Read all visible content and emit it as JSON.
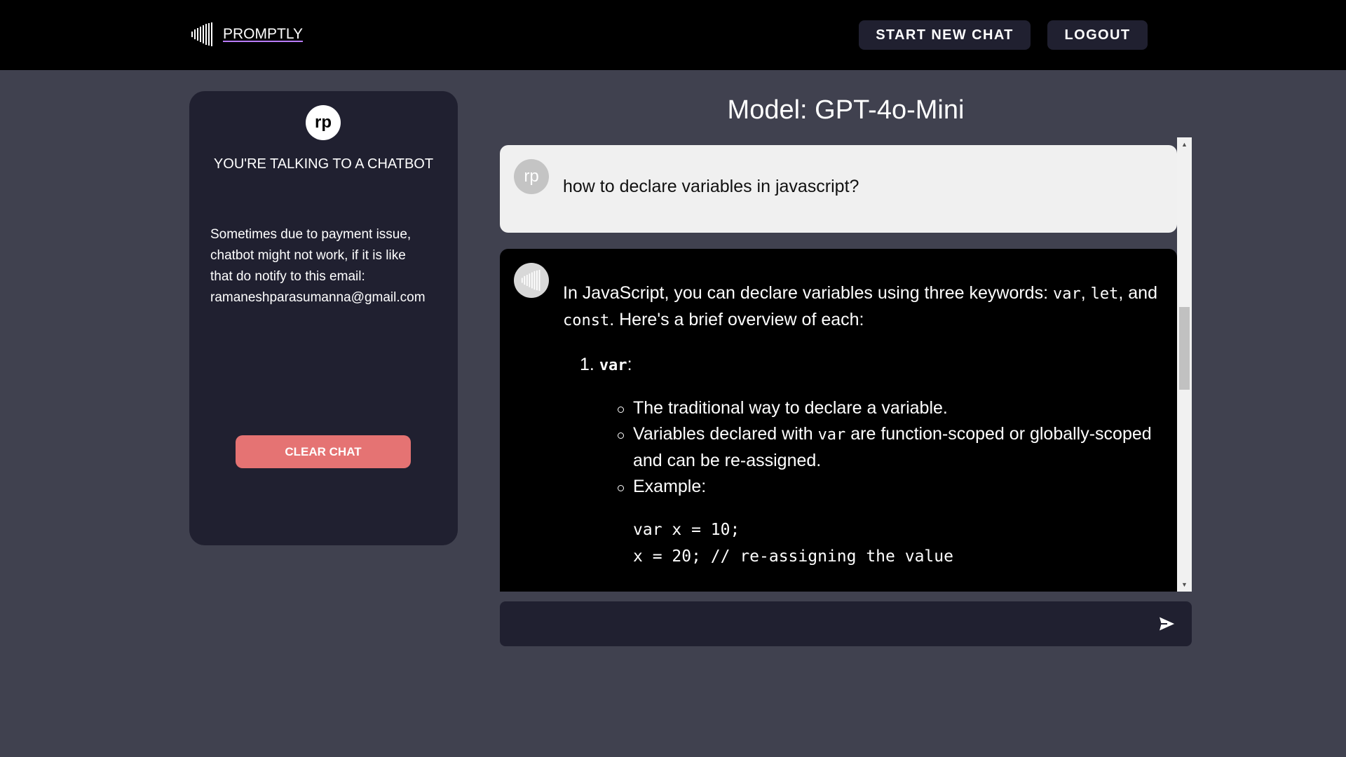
{
  "header": {
    "brand_name": "PROMPTLY",
    "new_chat_label": "START NEW CHAT",
    "logout_label": "LOGOUT"
  },
  "sidebar": {
    "avatar_initials": "rp",
    "title": "YOU'RE TALKING TO A CHATBOT",
    "note_lines": [
      "Sometimes due to payment issue,",
      "chatbot might not work, if it is like",
      "that do notify to this email:",
      "ramaneshparasumanna@gmail.com"
    ],
    "clear_label": "CLEAR CHAT"
  },
  "chat": {
    "model_title": "Model: GPT-4o-Mini",
    "user_message": {
      "avatar": "rp",
      "text": "how to declare variables in javascript?"
    },
    "bot_message": {
      "intro_a": "In JavaScript, you can declare variables using three keywords: ",
      "kw_var": "var",
      "sep1": ", ",
      "kw_let": "let",
      "sep2": ", and",
      "kw_const": "const",
      "intro_b": ". Here's a brief overview of each:",
      "list_number": "1.",
      "list_keyword": "var",
      "list_colon": ":",
      "bullet1": "The traditional way to declare a variable.",
      "bullet2_a": "Variables declared with ",
      "bullet2_code": "var",
      "bullet2_b": " are function-scoped or globally-scoped and can be re-assigned.",
      "bullet3": "Example:",
      "code_line1": "var x = 10;",
      "code_line2": "x = 20; // re-assigning the value"
    }
  },
  "input": {
    "placeholder": "",
    "value": ""
  },
  "colors": {
    "background": "#40414f",
    "topbar": "#000000",
    "panel": "#202030",
    "clear_button": "#e57373",
    "user_bubble": "#f0f0f0",
    "bot_bubble": "#000000"
  },
  "icons": {
    "logo": "soundwave-logo-icon",
    "send": "send-arrow-icon",
    "bot_avatar": "soundwave-avatar-icon"
  }
}
